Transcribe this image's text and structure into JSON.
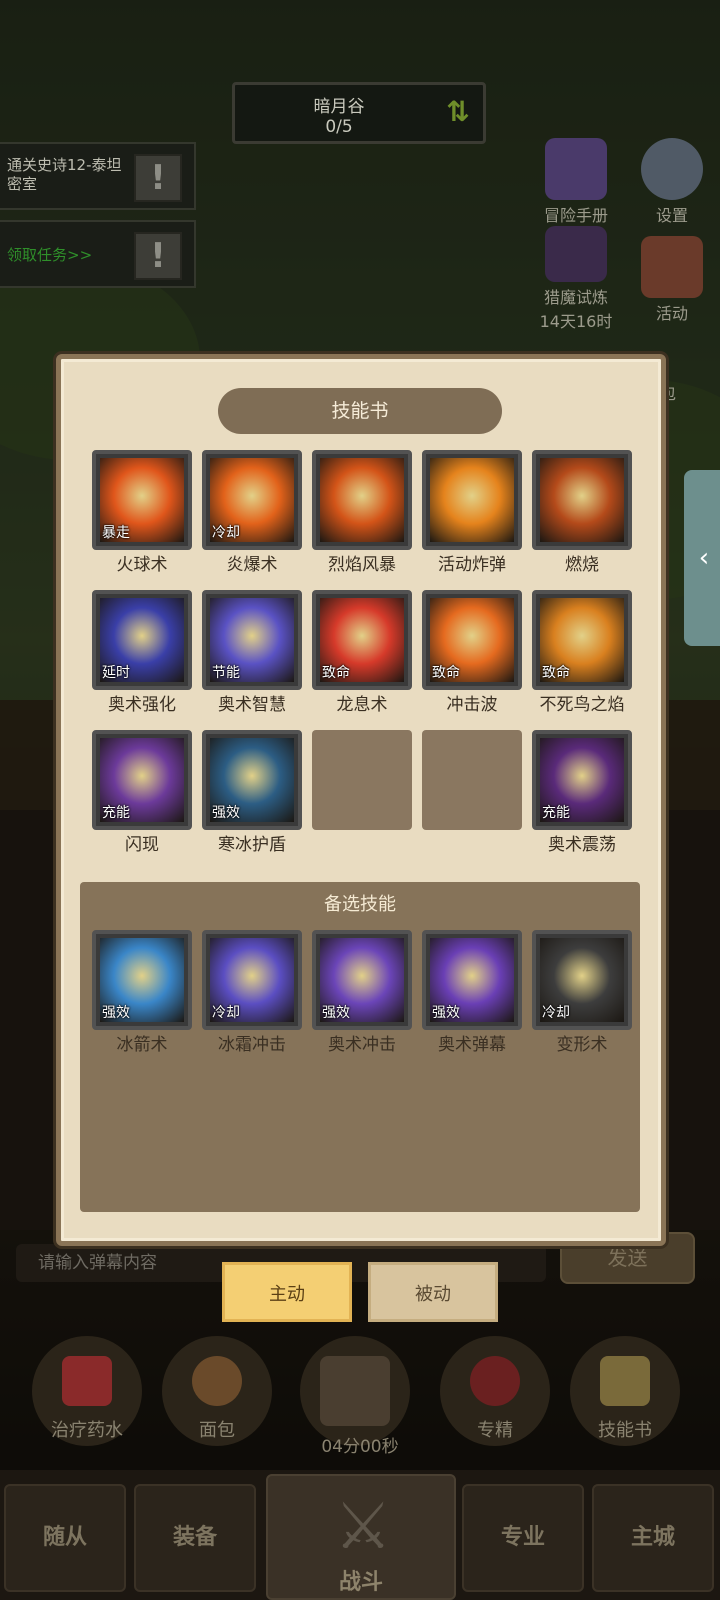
{
  "location": {
    "name": "暗月谷",
    "progress": "0/5"
  },
  "quests": [
    {
      "text": "通关史诗12-泰坦密室"
    },
    {
      "text": "领取任务>>"
    }
  ],
  "side_menu": {
    "adventure_manual": "冒险手册",
    "settings": "设置",
    "demon_hunt": "猎魔试炼",
    "demon_hunt_timer": "14天16时",
    "activity": "活动",
    "gift_partial": "包"
  },
  "panel": {
    "title": "技能书",
    "active_skills": [
      {
        "name": "火球术",
        "tag": "暴走",
        "color": "#e0561b"
      },
      {
        "name": "炎爆术",
        "tag": "冷却",
        "color": "#e2621a"
      },
      {
        "name": "烈焰风暴",
        "tag": "",
        "color": "#d35418"
      },
      {
        "name": "活动炸弹",
        "tag": "",
        "color": "#e5831c"
      },
      {
        "name": "燃烧",
        "tag": "",
        "color": "#b44a1a"
      },
      {
        "name": "奥术强化",
        "tag": "延时",
        "color": "#3a3fa8"
      },
      {
        "name": "奥术智慧",
        "tag": "节能",
        "color": "#5a52c4"
      },
      {
        "name": "龙息术",
        "tag": "致命",
        "color": "#d63a2a"
      },
      {
        "name": "冲击波",
        "tag": "致命",
        "color": "#e56a1f"
      },
      {
        "name": "不死鸟之焰",
        "tag": "致命",
        "color": "#d9801f"
      },
      {
        "name": "闪现",
        "tag": "充能",
        "color": "#6c3a9a"
      },
      {
        "name": "寒冰护盾",
        "tag": "强效",
        "color": "#2c5d84"
      },
      {
        "name": "奥术震荡",
        "tag": "充能",
        "color": "#5a2a7a"
      }
    ],
    "alt_title": "备选技能",
    "alt_skills": [
      {
        "name": "冰箭术",
        "tag": "强效",
        "color": "#3a86c8"
      },
      {
        "name": "冰霜冲击",
        "tag": "冷却",
        "color": "#5b4ec2"
      },
      {
        "name": "奥术冲击",
        "tag": "强效",
        "color": "#6b45b8"
      },
      {
        "name": "奥术弹幕",
        "tag": "强效",
        "color": "#6a3fb5"
      },
      {
        "name": "变形术",
        "tag": "冷却",
        "color": "#3d3d3d"
      }
    ]
  },
  "chat": {
    "placeholder": "请输入弹幕内容",
    "send": "发送"
  },
  "mode_tabs": {
    "active": "主动",
    "passive": "被动"
  },
  "actions": {
    "potion": "治疗药水",
    "bread": "面包",
    "chest_timer": "04分00秒",
    "specialize": "专精",
    "skillbook": "技能书"
  },
  "nav": {
    "follower": "随从",
    "equipment": "装备",
    "battle": "战斗",
    "profession": "专业",
    "city": "主城"
  }
}
